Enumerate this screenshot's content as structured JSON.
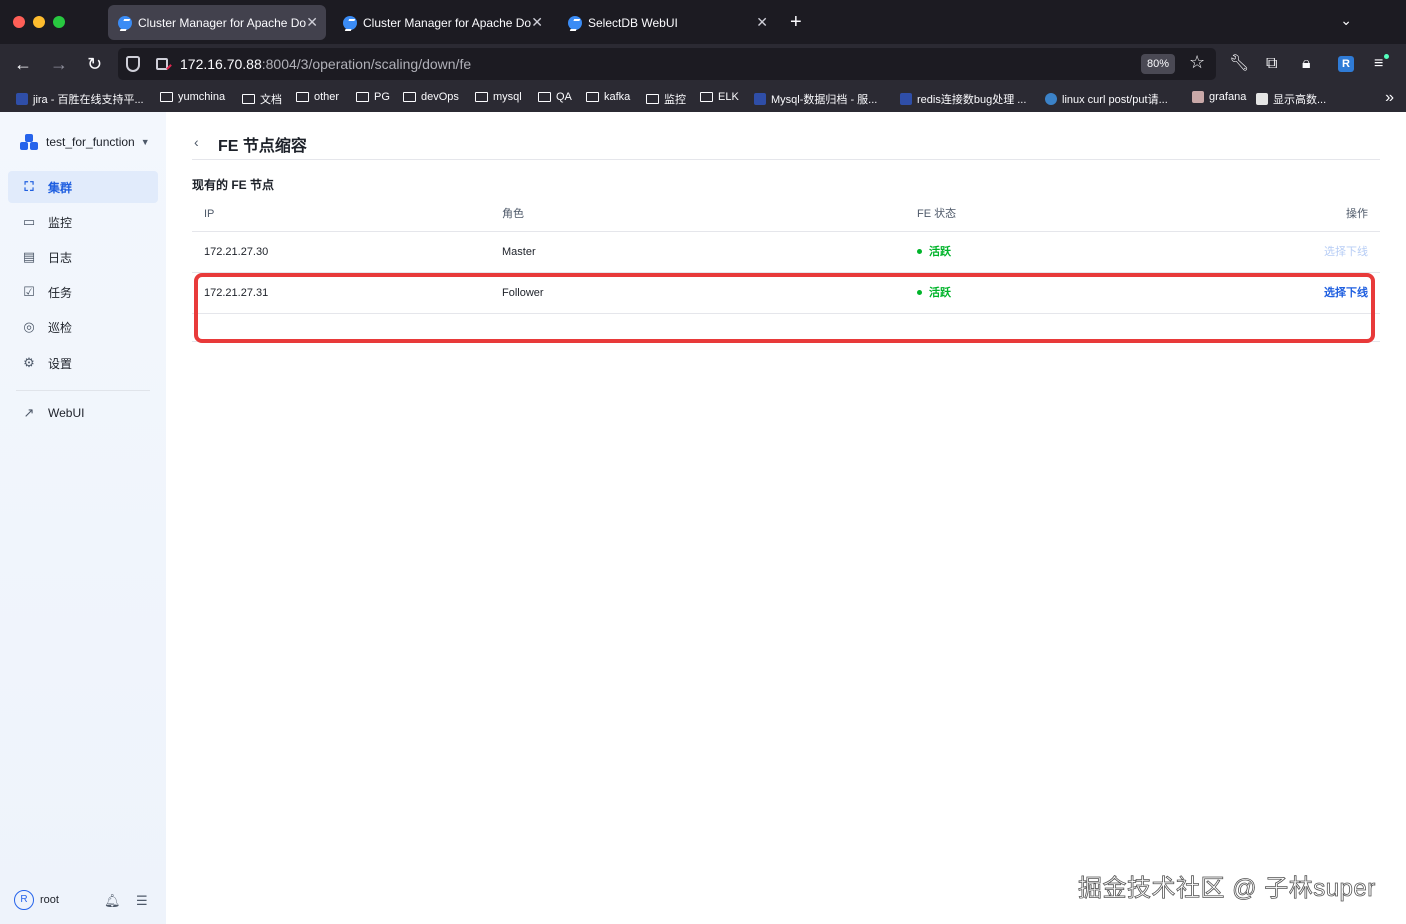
{
  "browser": {
    "tabs": [
      {
        "title": "Cluster Manager for Apache Doris",
        "active": true
      },
      {
        "title": "Cluster Manager for Apache Doris",
        "active": false
      },
      {
        "title": "SelectDB WebUI",
        "active": false
      }
    ],
    "url_host": "172.16.70.88",
    "url_rest": ":8004/3/operation/scaling/down/fe",
    "zoom": "80%",
    "bookmarks": [
      {
        "label": "jira - 百胜在线支持平...",
        "type": "site"
      },
      {
        "label": "yumchina",
        "type": "folder"
      },
      {
        "label": "文档",
        "type": "folder"
      },
      {
        "label": "other",
        "type": "folder"
      },
      {
        "label": "PG",
        "type": "folder"
      },
      {
        "label": "devOps",
        "type": "folder"
      },
      {
        "label": "mysql",
        "type": "folder"
      },
      {
        "label": "QA",
        "type": "folder"
      },
      {
        "label": "kafka",
        "type": "folder"
      },
      {
        "label": "监控",
        "type": "folder"
      },
      {
        "label": "ELK",
        "type": "folder"
      },
      {
        "label": "Mysql-数据归档 - 服...",
        "type": "site"
      },
      {
        "label": "redis连接数bug处理 ...",
        "type": "site"
      },
      {
        "label": "linux curl post/put请...",
        "type": "site"
      },
      {
        "label": "grafana",
        "type": "site"
      },
      {
        "label": "显示高数...",
        "type": "site"
      }
    ]
  },
  "sidebar": {
    "cluster_name": "test_for_function",
    "items": [
      {
        "label": "集群",
        "icon": "cluster-icon",
        "active": true
      },
      {
        "label": "监控",
        "icon": "monitor-icon",
        "active": false
      },
      {
        "label": "日志",
        "icon": "log-icon",
        "active": false
      },
      {
        "label": "任务",
        "icon": "task-icon",
        "active": false
      },
      {
        "label": "巡检",
        "icon": "inspection-icon",
        "active": false
      },
      {
        "label": "设置",
        "icon": "settings-icon",
        "active": false
      }
    ],
    "webui_label": "WebUI",
    "user": {
      "initial": "R",
      "name": "root"
    }
  },
  "main": {
    "title": "FE 节点缩容",
    "section_title": "现有的 FE 节点",
    "columns": [
      "IP",
      "角色",
      "FE 状态",
      "操作"
    ],
    "rows": [
      {
        "ip": "172.21.27.30",
        "role": "Master",
        "state": "活跃",
        "action": "选择下线",
        "action_enabled": false
      },
      {
        "ip": "172.21.27.31",
        "role": "Follower",
        "state": "活跃",
        "action": "选择下线",
        "action_enabled": true
      }
    ]
  },
  "watermark": "掘金技术社区 @ 子林super",
  "colors": {
    "accent": "#1f5fe0",
    "status_active": "#00b42a",
    "highlight": "#e83a3a"
  }
}
